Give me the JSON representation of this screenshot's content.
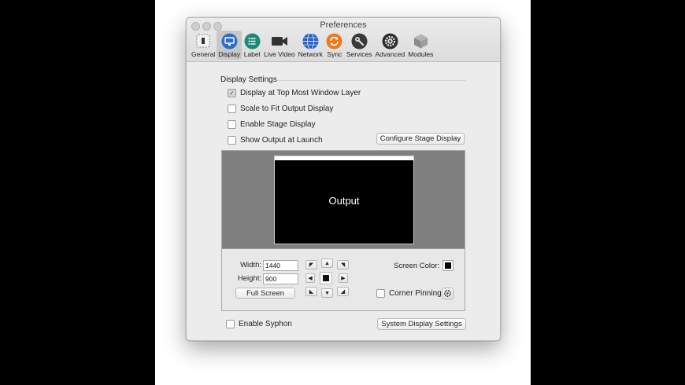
{
  "window": {
    "title": "Preferences"
  },
  "toolbar": {
    "items": [
      {
        "label": "General",
        "icon": "general-icon"
      },
      {
        "label": "Display",
        "icon": "display-icon"
      },
      {
        "label": "Label",
        "icon": "label-icon"
      },
      {
        "label": "Live Video",
        "icon": "video-camera-icon"
      },
      {
        "label": "Network",
        "icon": "globe-icon"
      },
      {
        "label": "Sync",
        "icon": "sync-icon"
      },
      {
        "label": "Services",
        "icon": "wrench-icon"
      },
      {
        "label": "Advanced",
        "icon": "gear-icon"
      },
      {
        "label": "Modules",
        "icon": "cube-icon"
      }
    ],
    "selected": "Display"
  },
  "display_settings": {
    "section_title": "Display Settings",
    "options": [
      {
        "label": "Display at Top Most Window Layer",
        "checked": true
      },
      {
        "label": "Scale to Fit Output Display",
        "checked": false
      },
      {
        "label": "Enable Stage Display",
        "checked": false
      },
      {
        "label": "Show Output at Launch",
        "checked": false
      }
    ],
    "configure_stage_button": "Configure Stage Display"
  },
  "preview": {
    "output_label": "Output"
  },
  "geometry": {
    "width_label": "Width:",
    "width_value": "1440",
    "height_label": "Height:",
    "height_value": "900",
    "full_screen_button": "Full Screen",
    "screen_color_label": "Screen Color:",
    "screen_color": "#000000",
    "corner_pinning_label": "Corner Pinning",
    "corner_pinning_checked": false
  },
  "footer": {
    "enable_syphon_label": "Enable Syphon",
    "enable_syphon_checked": false,
    "system_display_button": "System Display Settings"
  },
  "colors": {
    "selected_tab_bg": "#c8c8c8",
    "preview_bg": "#7f7f7f",
    "output_bg": "#000000"
  }
}
